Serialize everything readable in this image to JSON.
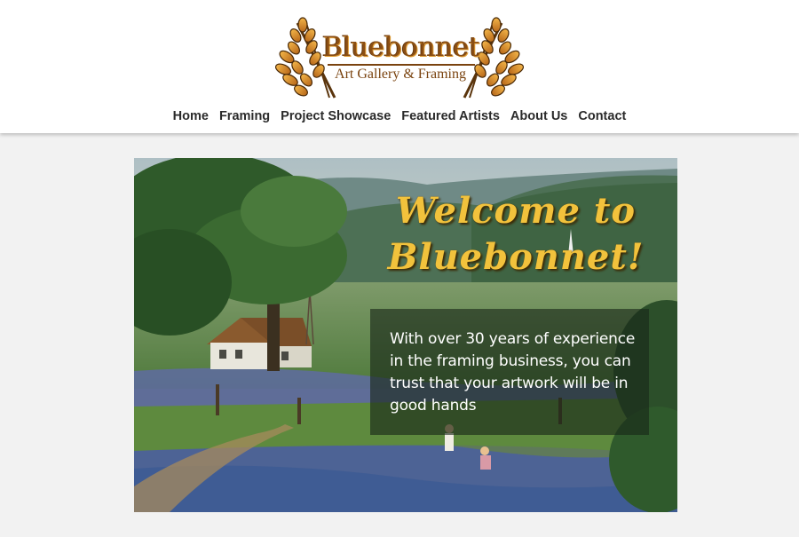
{
  "logo": {
    "title": "Bluebonnet",
    "subtitle": "Art Gallery & Framing",
    "icon": "wheat-icon",
    "colors": {
      "gold": "#d9902a",
      "brown": "#7a430f"
    }
  },
  "nav": {
    "items": [
      {
        "label": "Home"
      },
      {
        "label": "Framing"
      },
      {
        "label": "Project Showcase"
      },
      {
        "label": "Featured Artists"
      },
      {
        "label": "About Us"
      },
      {
        "label": "Contact"
      }
    ]
  },
  "hero": {
    "welcome_line1": "Welcome to",
    "welcome_line2": "Bluebonnet!",
    "body": "With over 30 years of experience in the framing business, you can trust that your artwork will be in good hands",
    "colors": {
      "headline": "#f2c23c",
      "overlay": "#192619",
      "page_bg": "#f2f2f2"
    }
  }
}
